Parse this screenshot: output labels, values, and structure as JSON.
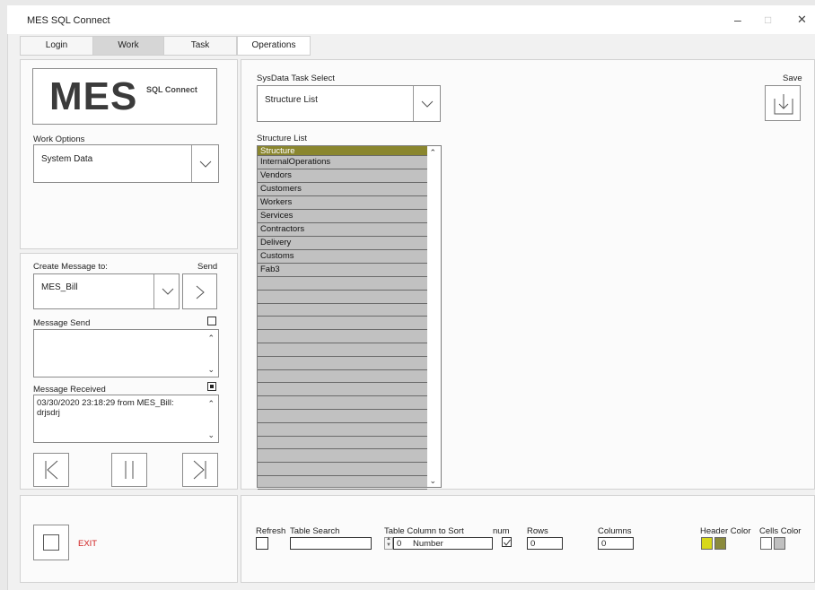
{
  "window": {
    "title": "MES SQL Connect",
    "minimize": "–",
    "maximize": "□",
    "close": "✕"
  },
  "tabs": [
    {
      "label": "Login"
    },
    {
      "label": "Work"
    },
    {
      "label": "Task"
    },
    {
      "label": "Operations"
    }
  ],
  "logo": {
    "main": "MES",
    "sub": "SQL Connect"
  },
  "work_options": {
    "label": "Work Options",
    "value": "System Data"
  },
  "message": {
    "create_label": "Create Message to:",
    "send_label": "Send",
    "recipient": "MES_Bill",
    "send_section_label": "Message Send",
    "send_text": "",
    "received_label": "Message Received",
    "received_lines": [
      "03/30/2020  23:18:29 from MES_Bill:",
      "drjsdrj"
    ]
  },
  "task_select": {
    "label": "SysData Task Select",
    "value": "Structure List"
  },
  "save": {
    "label": "Save"
  },
  "structure_list": {
    "label": "Structure List",
    "items": [
      "Structure",
      "InternalOperations",
      "Vendors",
      "Customers",
      "Workers",
      "Services",
      "Contractors",
      "Delivery",
      "Customs",
      "Fab3",
      "",
      "",
      "",
      "",
      "",
      "",
      "",
      "",
      "",
      "",
      "",
      "",
      "",
      "",
      "",
      ""
    ]
  },
  "exit": {
    "label": "EXIT"
  },
  "bottom": {
    "refresh_label": "Refresh",
    "table_search_label": "Table Search",
    "table_search_value": "",
    "sort_label": "Table Column to Sort",
    "sort_index": "0",
    "sort_column": "Number",
    "num_label": "num",
    "rows_label": "Rows",
    "rows_value": "0",
    "columns_label": "Columns",
    "columns_value": "0",
    "header_color_label": "Header Color",
    "cells_color_label": "Cells Color"
  },
  "colors": {
    "header_row": "#8a862e",
    "list_bg": "#c1c1c1",
    "exit_text": "#d02020",
    "header_swatch_a": "#d7d81a",
    "header_swatch_b": "#8a8a3c",
    "cells_swatch_a": "#ffffff",
    "cells_swatch_b": "#c0c0c0"
  }
}
